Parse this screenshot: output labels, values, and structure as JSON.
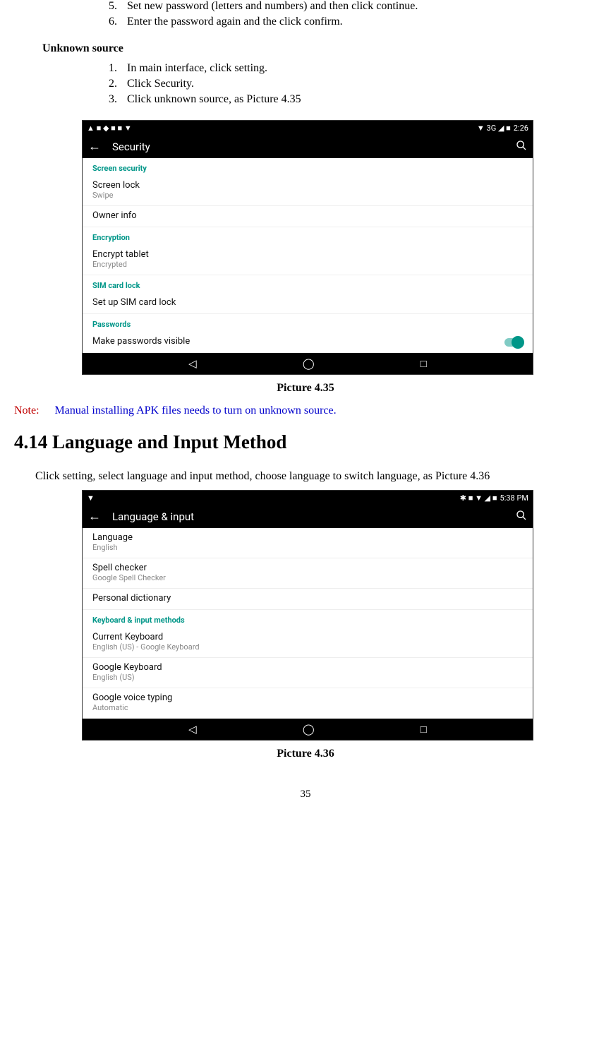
{
  "steps_prev": [
    {
      "num": "5.",
      "text": "Set new password (letters and numbers) and then click continue."
    },
    {
      "num": "6.",
      "text": "Enter the password again and the click confirm."
    }
  ],
  "subhead_unknown": "Unknown source",
  "steps_unknown": [
    {
      "num": "1.",
      "text": "In main interface, click setting."
    },
    {
      "num": "2.",
      "text": "Click Security."
    },
    {
      "num": "3.",
      "text": "Click unknown source, as Picture 4.35"
    }
  ],
  "shot1": {
    "status_left_icons": "▲ ■ ◆ ■ ■ ▼",
    "status_right_net": "▼ 3G ◢ ■",
    "status_right_time": "2:26",
    "toolbar_title": "Security",
    "groups": [
      {
        "head": "Screen security",
        "rows": [
          {
            "t1": "Screen lock",
            "t2": "Swipe"
          },
          {
            "t1": "Owner info",
            "t2": ""
          }
        ]
      },
      {
        "head": "Encryption",
        "rows": [
          {
            "t1": "Encrypt tablet",
            "t2": "Encrypted"
          }
        ]
      },
      {
        "head": "SIM card lock",
        "rows": [
          {
            "t1": "Set up SIM card lock",
            "t2": ""
          }
        ]
      },
      {
        "head": "Passwords",
        "rows": [
          {
            "t1": "Make passwords visible",
            "t2": "",
            "toggle": true
          }
        ]
      }
    ]
  },
  "caption1": "Picture 4.35",
  "note_label": "Note:",
  "note_text": "Manual installing APK files needs to turn on unknown source.",
  "section_heading": "4.14  Language and Input Method",
  "body_para": "Click setting, select language and input method, choose language to switch language, as Picture 4.36",
  "shot2": {
    "status_left_icons": "▼",
    "status_right_net": "✱ ■ ▼ ◢ ■",
    "status_right_time": "5:38 PM",
    "toolbar_title": "Language & input",
    "rows_top": [
      {
        "t1": "Language",
        "t2": "English"
      },
      {
        "t1": "Spell checker",
        "t2": "Google Spell Checker"
      },
      {
        "t1": "Personal dictionary",
        "t2": ""
      }
    ],
    "group_head": "Keyboard & input methods",
    "rows_kim": [
      {
        "t1": "Current Keyboard",
        "t2": "English (US) - Google Keyboard"
      },
      {
        "t1": "Google Keyboard",
        "t2": "English (US)"
      },
      {
        "t1": "Google voice typing",
        "t2": "Automatic"
      }
    ]
  },
  "caption2": "Picture 4.36",
  "page_number": "35"
}
